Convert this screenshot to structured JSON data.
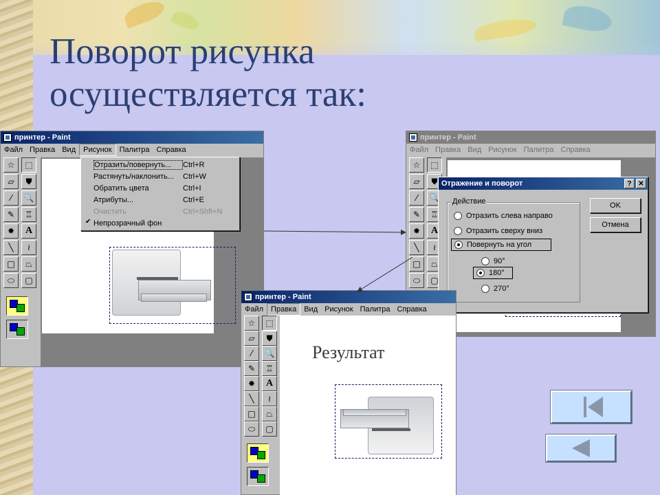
{
  "slide": {
    "title_line1": "Поворот рисунка",
    "title_line2": "осуществляется так:",
    "result_label": "Результат"
  },
  "window_left": {
    "title": "принтер - Paint",
    "menu": [
      "Файл",
      "Правка",
      "Вид",
      "Рисунок",
      "Палитра",
      "Справка"
    ],
    "open_menu": "Рисунок"
  },
  "image_menu": {
    "items": [
      {
        "label": "Отразить/повернуть...",
        "shortcut": "Ctrl+R"
      },
      {
        "label": "Растянуть/наклонить...",
        "shortcut": "Ctrl+W"
      },
      {
        "label": "Обратить цвета",
        "shortcut": "Ctrl+I"
      },
      {
        "label": "Атрибуты...",
        "shortcut": "Ctrl+E"
      },
      {
        "label": "Очистить",
        "shortcut": "Ctrl+Shft+N"
      },
      {
        "label": "Непрозрачный фон",
        "shortcut": ""
      }
    ]
  },
  "window_right": {
    "title": "принтер - Paint",
    "menu": [
      "Файл",
      "Правка",
      "Вид",
      "Рисунок",
      "Палитра",
      "Справка"
    ]
  },
  "dialog": {
    "title": "Отражение и поворот",
    "help_btn": "?",
    "close_btn": "✕",
    "group_label": "Действие",
    "options": [
      "Отразить слева направо",
      "Отразить сверху вниз",
      "Повернуть на угол"
    ],
    "selected_option": "Повернуть на угол",
    "angles": [
      "90°",
      "180°",
      "270°"
    ],
    "selected_angle": "180°",
    "ok": "OK",
    "cancel": "Отмена"
  },
  "window_bottom": {
    "title": "принтер - Paint",
    "menu": [
      "Файл",
      "Правка",
      "Вид",
      "Рисунок",
      "Палитра",
      "Справка"
    ]
  },
  "tools": [
    {
      "icon": "free-select-icon",
      "glyph": "☆"
    },
    {
      "icon": "rect-select-icon",
      "glyph": "⬚"
    },
    {
      "icon": "eraser-icon",
      "glyph": "▱"
    },
    {
      "icon": "fill-icon",
      "glyph": "⛊"
    },
    {
      "icon": "picker-icon",
      "glyph": "⁄"
    },
    {
      "icon": "magnifier-icon",
      "glyph": "🔍"
    },
    {
      "icon": "pencil-icon",
      "glyph": "✎"
    },
    {
      "icon": "brush-icon",
      "glyph": "♖"
    },
    {
      "icon": "airbrush-icon",
      "glyph": "✸"
    },
    {
      "icon": "text-icon",
      "glyph": "A"
    },
    {
      "icon": "line-icon",
      "glyph": "╲"
    },
    {
      "icon": "curve-icon",
      "glyph": "≀"
    },
    {
      "icon": "rectangle-icon",
      "glyph": "□"
    },
    {
      "icon": "polygon-icon",
      "glyph": "⏢"
    },
    {
      "icon": "ellipse-icon",
      "glyph": "⬭"
    },
    {
      "icon": "rounded-rect-icon",
      "glyph": "▢"
    }
  ],
  "nav": {
    "first_slide_icon": "first-slide-icon",
    "back_icon": "back-icon"
  }
}
